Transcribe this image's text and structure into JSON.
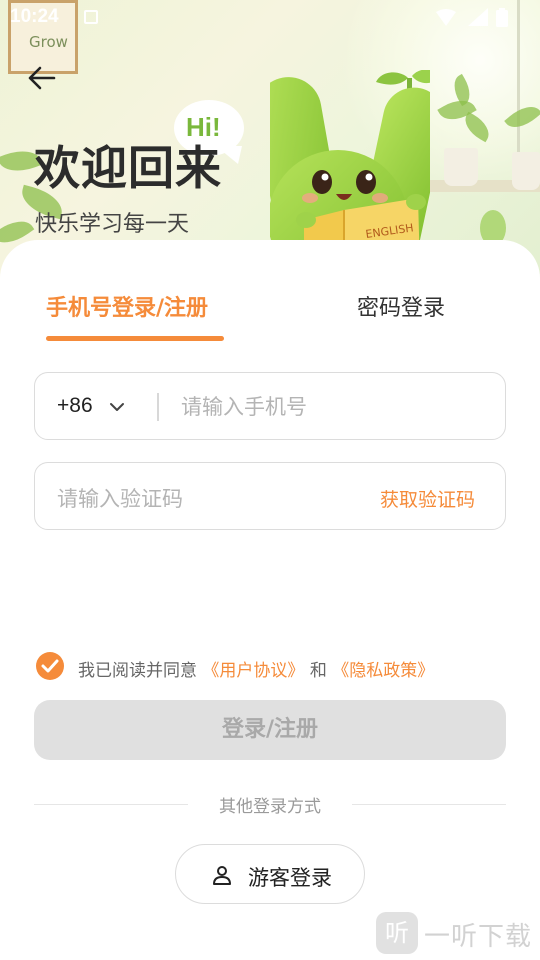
{
  "status_bar": {
    "time": "10:24"
  },
  "hero": {
    "poster_text": "Grow",
    "bubble_text": "Hi!",
    "title": "欢迎回来",
    "subtitle": "快乐学习每一天",
    "book_text": "ENGLISH"
  },
  "tabs": [
    {
      "label": "手机号登录/注册",
      "active": true
    },
    {
      "label": "密码登录",
      "active": false
    }
  ],
  "phone_field": {
    "country_code": "+86",
    "placeholder": "请输入手机号",
    "value": ""
  },
  "code_field": {
    "placeholder": "请输入验证码",
    "value": "",
    "get_code_label": "获取验证码"
  },
  "agreement": {
    "checked": true,
    "prefix": "我已阅读并同意",
    "user_agreement": "《用户协议》",
    "conjunction": "和",
    "privacy_policy": "《隐私政策》"
  },
  "login_button": {
    "label": "登录/注册",
    "enabled": false
  },
  "other_methods": {
    "divider_label": "其他登录方式",
    "guest_label": "游客登录"
  },
  "watermark": {
    "logo_char": "听",
    "text": "一听下载"
  },
  "colors": {
    "accent": "#f58b3a",
    "disabled_button": "#e0e0e0",
    "title_text": "#2c2c2c"
  },
  "icons": {
    "back": "arrow-left-icon",
    "dropdown": "chevron-down-icon",
    "check": "check-circle-icon",
    "guest": "person-icon"
  }
}
